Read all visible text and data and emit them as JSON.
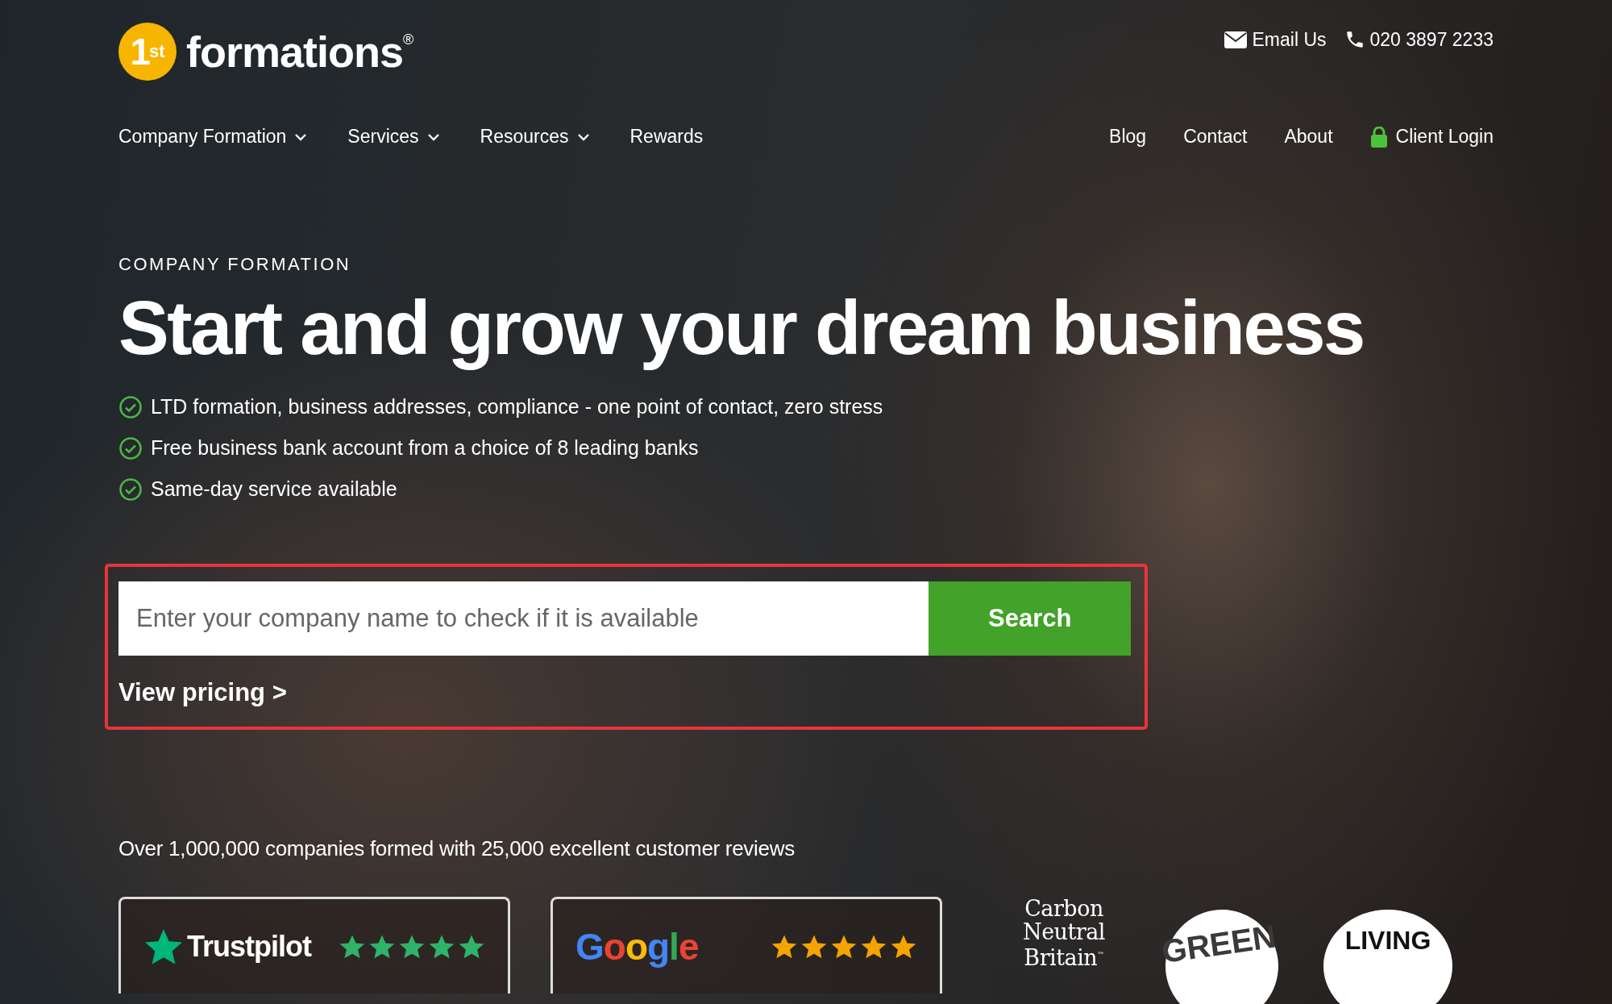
{
  "logo": {
    "mark": "1",
    "mark_sup": "st",
    "wordmark": "formations",
    "registered": "®"
  },
  "contact": [
    {
      "kind": "email",
      "label": "Email Us"
    },
    {
      "kind": "phone",
      "label": "020 3897 2233"
    }
  ],
  "nav_left": [
    {
      "label": "Company Formation",
      "dropdown": true
    },
    {
      "label": "Services",
      "dropdown": true
    },
    {
      "label": "Resources",
      "dropdown": true
    },
    {
      "label": "Rewards",
      "dropdown": false
    }
  ],
  "nav_right": [
    {
      "label": "Blog",
      "kind": "link"
    },
    {
      "label": "Contact",
      "kind": "link"
    },
    {
      "label": "About",
      "kind": "link"
    },
    {
      "label": "Client Login",
      "kind": "login"
    }
  ],
  "hero": {
    "eyebrow": "COMPANY FORMATION",
    "headline": "Start and grow your dream business",
    "features": [
      "LTD formation, business addresses, compliance - one point of contact, zero stress",
      "Free business bank account from a choice of 8 leading banks",
      "Same-day service available"
    ]
  },
  "search": {
    "placeholder": "Enter your company name to check if it is available",
    "button": "Search",
    "link": "View pricing >"
  },
  "social_proof": "Over 1,000,000 companies formed with 25,000 excellent customer reviews",
  "reviews": [
    {
      "kind": "trustpilot",
      "brand": "Trustpilot",
      "stars": 5
    },
    {
      "kind": "google",
      "brand": "Google",
      "stars": 5
    }
  ],
  "badges": [
    {
      "kind": "text",
      "lines": [
        "Carbon",
        "Neutral",
        "Britain$^{™}$"
      ]
    },
    {
      "kind": "circle",
      "label": "GREEN"
    },
    {
      "kind": "cloud",
      "label": "LIVING"
    }
  ]
}
